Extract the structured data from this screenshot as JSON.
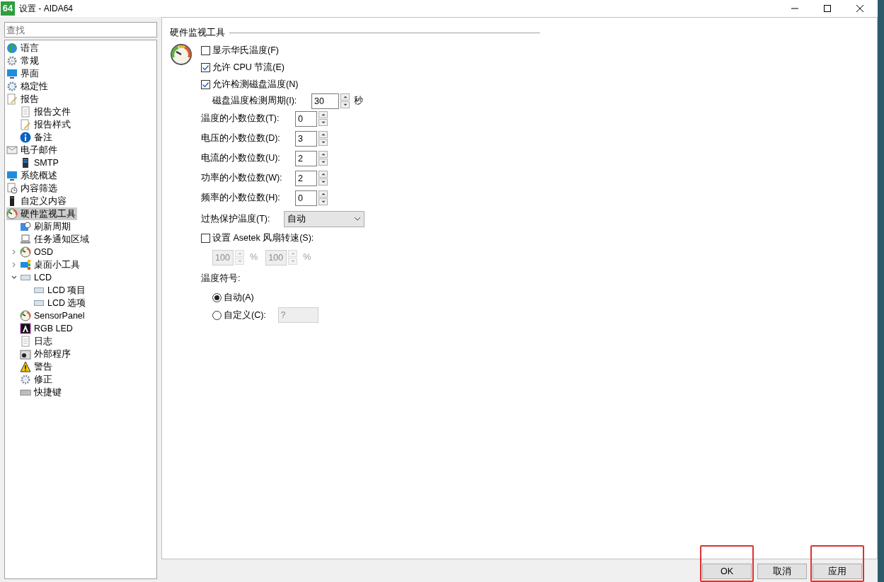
{
  "window": {
    "title": "设置 - AIDA64",
    "app_badge": "64"
  },
  "sidebar": {
    "search": {
      "placeholder": "查找"
    },
    "tree": [
      {
        "label": "语言",
        "selected": false
      },
      {
        "label": "常规",
        "selected": false
      },
      {
        "label": "界面",
        "selected": false
      },
      {
        "label": "稳定性",
        "selected": false
      },
      {
        "label": "报告",
        "selected": false,
        "children": [
          {
            "label": "报告文件",
            "selected": false
          },
          {
            "label": "报告样式",
            "selected": false
          },
          {
            "label": "备注",
            "selected": false
          }
        ]
      },
      {
        "label": "电子邮件",
        "selected": false,
        "children": [
          {
            "label": "SMTP",
            "selected": false
          }
        ]
      },
      {
        "label": "系统概述",
        "selected": false
      },
      {
        "label": "内容筛选",
        "selected": false
      },
      {
        "label": "自定义内容",
        "selected": false
      },
      {
        "label": "硬件监视工具",
        "selected": true,
        "children": [
          {
            "label": "刷新周期",
            "selected": false
          },
          {
            "label": "任务通知区域",
            "selected": false
          },
          {
            "label": "OSD",
            "selected": false,
            "expanded": false
          },
          {
            "label": "桌面小工具",
            "selected": false,
            "expanded": false
          },
          {
            "label": "LCD",
            "selected": false,
            "expanded": true,
            "children": [
              {
                "label": "LCD 项目",
                "selected": false
              },
              {
                "label": "LCD 选项",
                "selected": false
              }
            ]
          },
          {
            "label": "SensorPanel",
            "selected": false
          },
          {
            "label": "RGB LED",
            "selected": false
          },
          {
            "label": "日志",
            "selected": false
          },
          {
            "label": "外部程序",
            "selected": false
          },
          {
            "label": "警告",
            "selected": false
          },
          {
            "label": "修正",
            "selected": false
          },
          {
            "label": "快捷键",
            "selected": false
          }
        ]
      }
    ]
  },
  "panel": {
    "title": "硬件监视工具",
    "controls": [
      {
        "kind": "checkbox",
        "label": "显示华氏温度(F)",
        "checked": false
      },
      {
        "kind": "checkbox",
        "label": "允许 CPU 节流(E)",
        "checked": true
      },
      {
        "kind": "checkbox",
        "label": "允许检测磁盘温度(N)",
        "checked": true
      },
      {
        "kind": "spinner",
        "label": "磁盘温度检测周期(I):",
        "value": "30",
        "unit": "秒",
        "indent": true
      },
      {
        "kind": "spinner",
        "label": "温度的小数位数(T):",
        "value": "0"
      },
      {
        "kind": "spinner",
        "label": "电压的小数位数(D):",
        "value": "3"
      },
      {
        "kind": "spinner",
        "label": "电流的小数位数(U):",
        "value": "2"
      },
      {
        "kind": "spinner",
        "label": "功率的小数位数(W):",
        "value": "2"
      },
      {
        "kind": "spinner",
        "label": "频率的小数位数(H):",
        "value": "0"
      },
      {
        "kind": "dropdown",
        "label": "过热保护温度(T):",
        "value": "自动"
      },
      {
        "kind": "checkbox",
        "label": "设置 Asetek 风扇转速(S):",
        "checked": false
      },
      {
        "kind": "pair",
        "disabled": true,
        "fields": [
          {
            "value": "100",
            "unit": "%"
          },
          {
            "value": "100",
            "unit": "%"
          }
        ]
      },
      {
        "kind": "heading",
        "label": "温度符号:"
      },
      {
        "kind": "radio",
        "label": "自动(A)",
        "selected": true
      },
      {
        "kind": "radio",
        "label": "自定义(C):",
        "selected": false,
        "field": {
          "value": "?",
          "disabled": true
        }
      }
    ]
  },
  "buttons": [
    {
      "label": "OK",
      "highlighted": true
    },
    {
      "label": "取消",
      "highlighted": false
    },
    {
      "label": "应用",
      "highlighted": true
    }
  ]
}
